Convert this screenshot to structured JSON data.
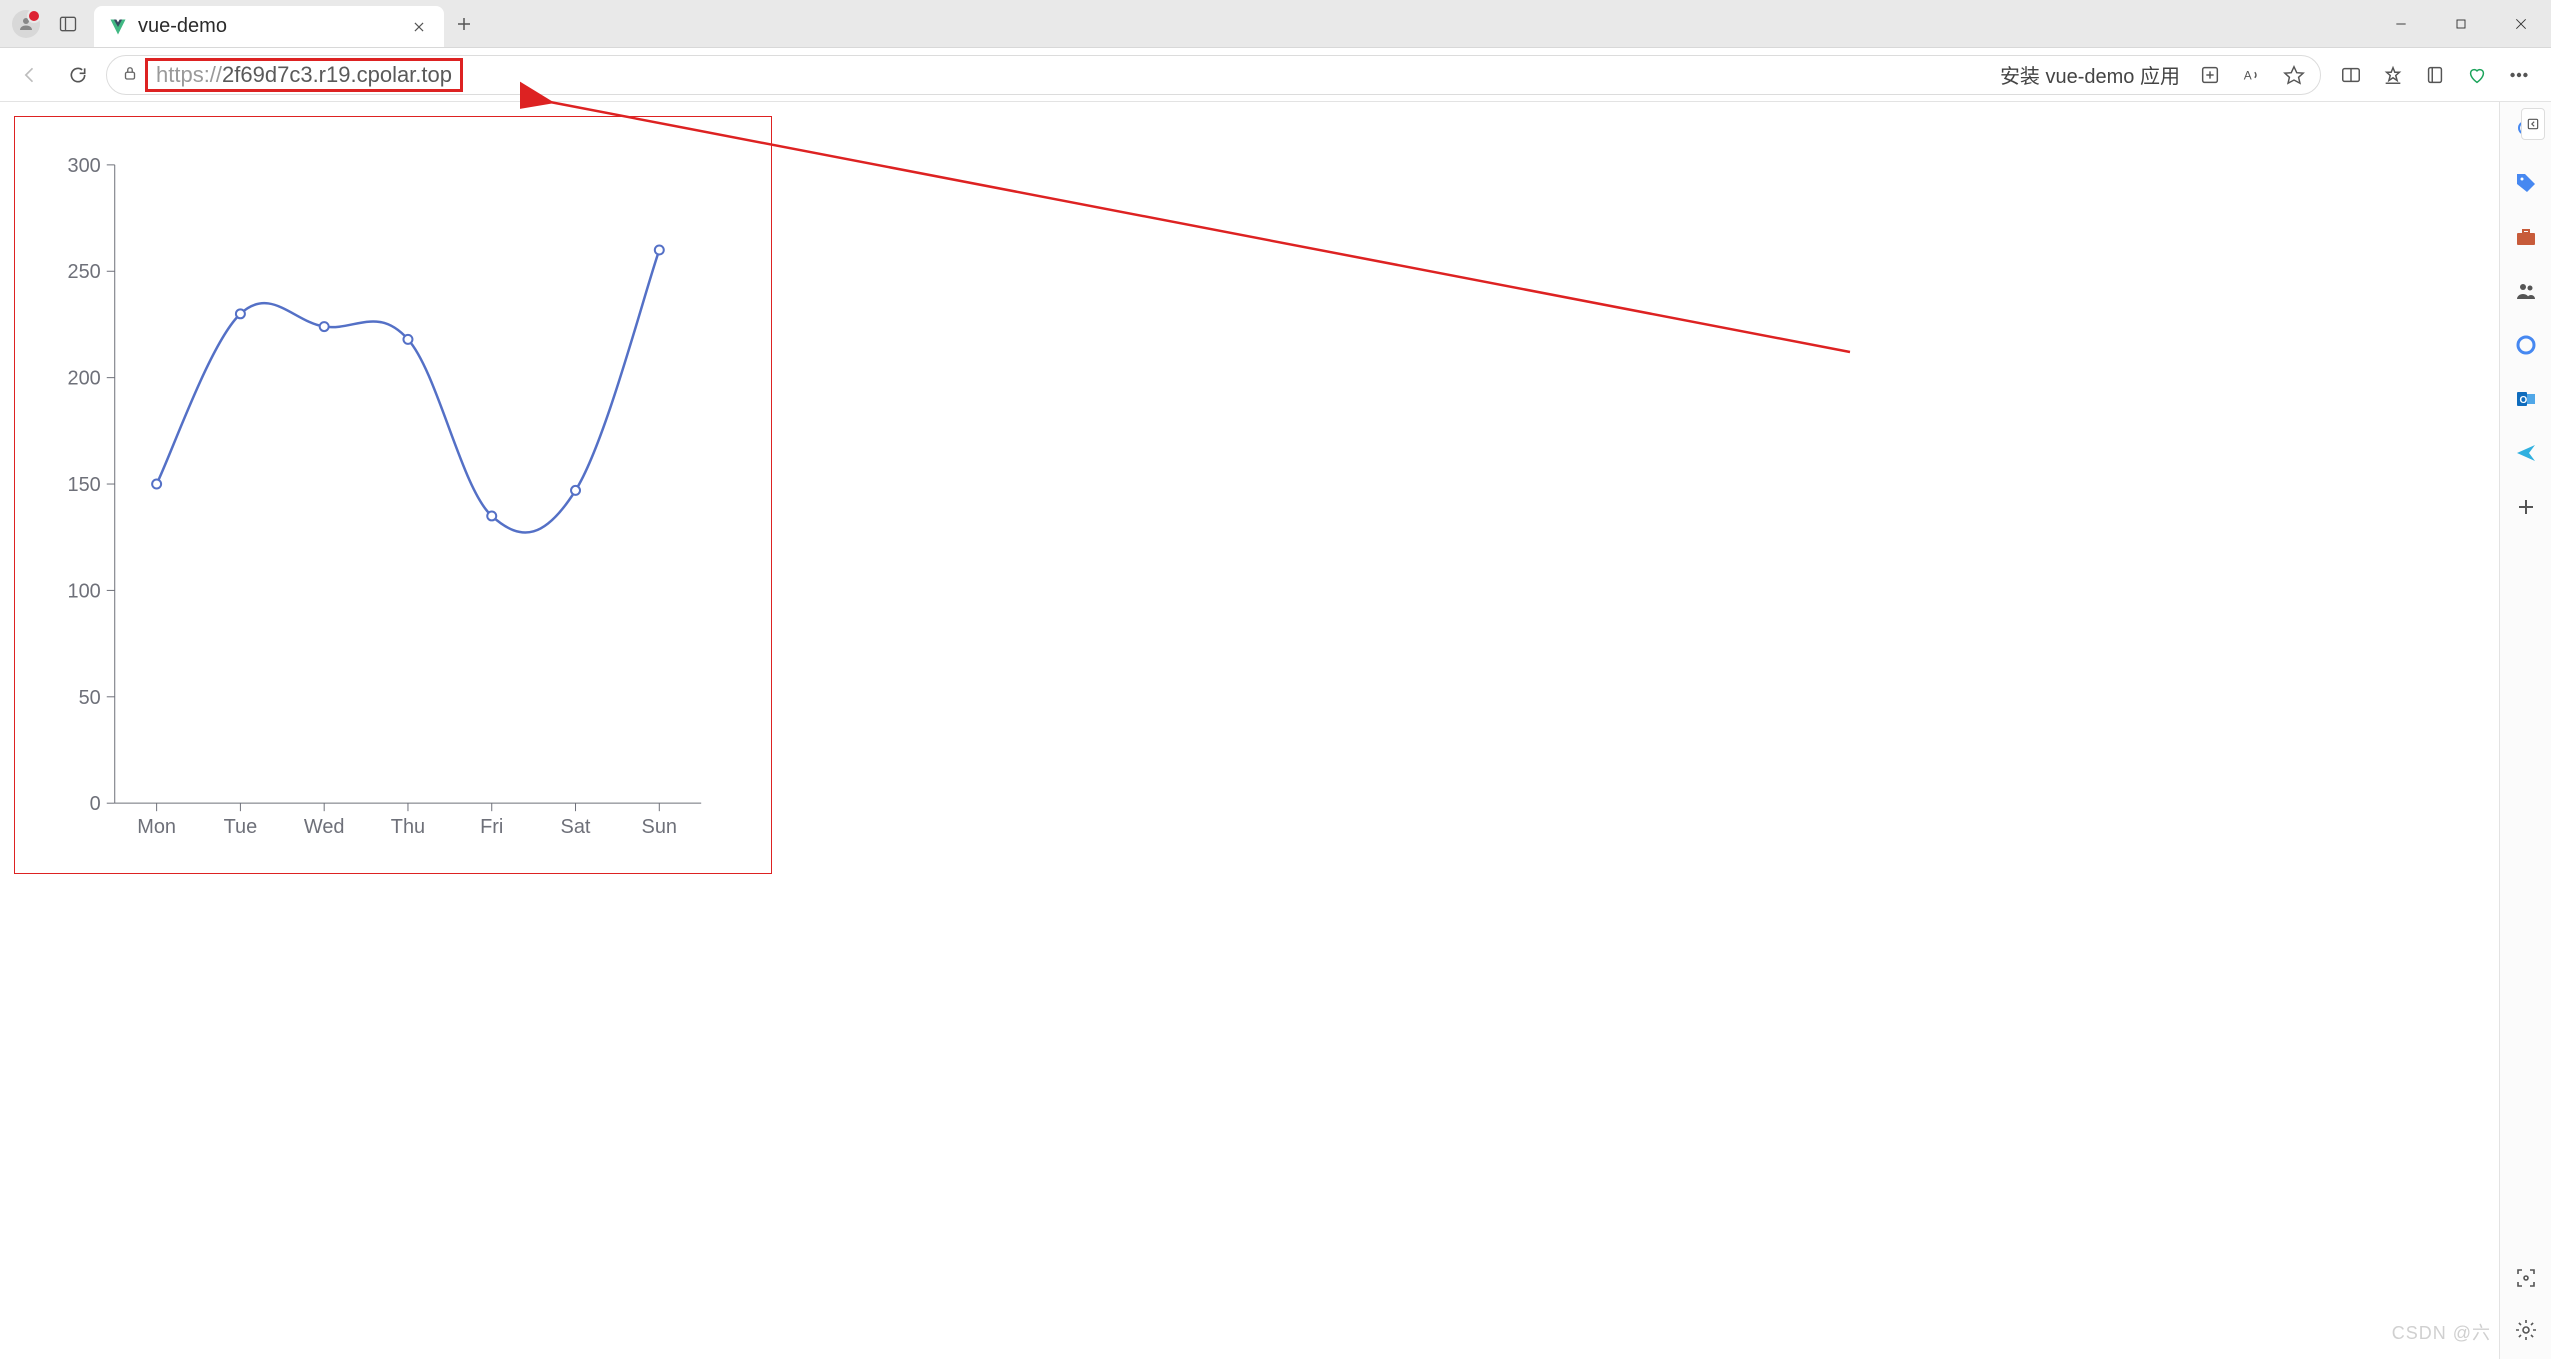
{
  "browser": {
    "tab_title": "vue-demo",
    "url_scheme": "https://",
    "url_host_path": "2f69d7c3.r19.cpolar.top",
    "pwa_prompt": "安装 vue-demo 应用"
  },
  "sidebar_icons": [
    "search-icon",
    "tag-icon",
    "briefcase-icon",
    "people-icon",
    "circle-icon",
    "outlook-icon",
    "send-icon",
    "add-icon"
  ],
  "highlight": {
    "box": true,
    "arrow": true
  },
  "watermark": "CSDN @六",
  "chart_data": {
    "type": "line",
    "smooth": true,
    "title": "",
    "xlabel": "",
    "ylabel": "",
    "categories": [
      "Mon",
      "Tue",
      "Wed",
      "Thu",
      "Fri",
      "Sat",
      "Sun"
    ],
    "values": [
      150,
      230,
      224,
      218,
      135,
      147,
      260
    ],
    "ylim": [
      0,
      300
    ],
    "yticks": [
      0,
      50,
      100,
      150,
      200,
      250,
      300
    ],
    "series_color": "#5470c6"
  }
}
